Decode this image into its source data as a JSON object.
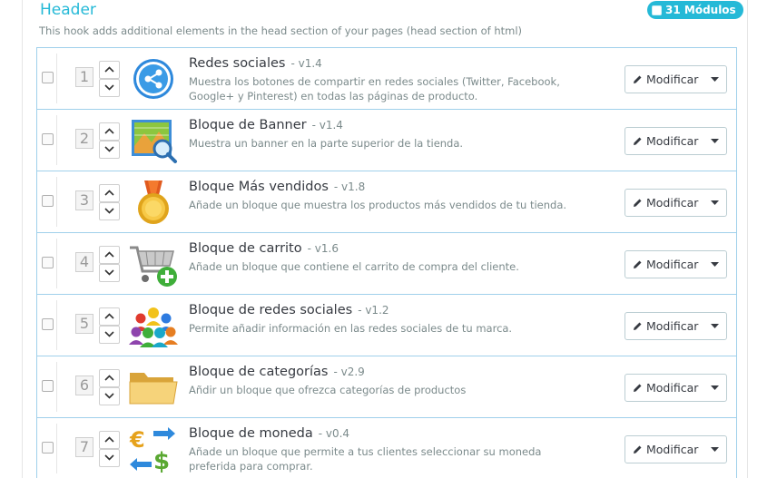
{
  "header": {
    "title": "Header",
    "description": "This hook adds additional elements in the head section of your pages (head section of html)",
    "badge": "31 Módulos"
  },
  "colors": {
    "accent": "#25b9d7",
    "border": "#a0d0eb"
  },
  "button_label": "Modificar",
  "modules": [
    {
      "position": "1",
      "name": "Redes sociales",
      "version": "- v1.4",
      "description": "Muestra los botones de compartir en redes sociales (Twitter, Facebook, Google+ y Pinterest) en todas las páginas de producto.",
      "icon": "share-icon"
    },
    {
      "position": "2",
      "name": "Bloque de Banner",
      "version": "- v1.4",
      "description": "Muestra un banner en la parte superior de la tienda.",
      "icon": "banner-icon"
    },
    {
      "position": "3",
      "name": "Bloque Más vendidos",
      "version": "- v1.8",
      "description": "Añade un bloque que muestra los productos más vendidos de tu tienda.",
      "icon": "medal-icon"
    },
    {
      "position": "4",
      "name": "Bloque de carrito",
      "version": "- v1.6",
      "description": "Añade un bloque que contiene el carrito de compra del cliente.",
      "icon": "cart-icon"
    },
    {
      "position": "5",
      "name": "Bloque de redes sociales",
      "version": "- v1.2",
      "description": "Permite añadir información en las redes sociales de tu marca.",
      "icon": "people-icon"
    },
    {
      "position": "6",
      "name": "Bloque de categorías",
      "version": "- v2.9",
      "description": "Añdir un bloque que ofrezca categorías de productos",
      "icon": "folder-icon"
    },
    {
      "position": "7",
      "name": "Bloque de moneda",
      "version": "- v0.4",
      "description": "Añade un bloque que permite a tus clientes seleccionar su moneda preferida para comprar.",
      "icon": "currency-icon"
    }
  ]
}
